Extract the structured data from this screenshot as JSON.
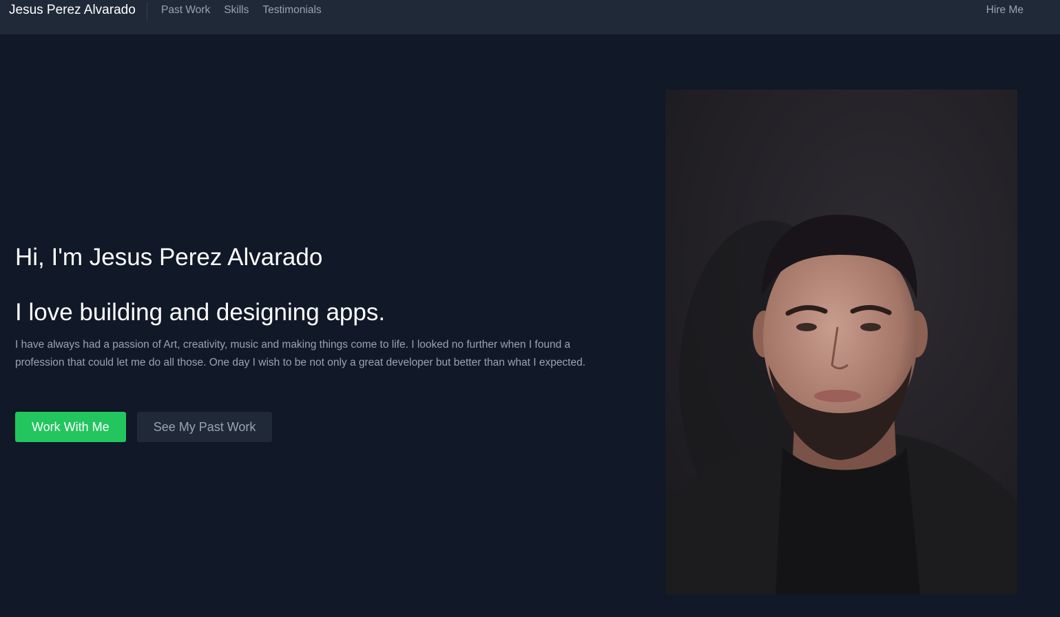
{
  "navbar": {
    "brand": "Jesus Perez Alvarado",
    "links": [
      "Past Work",
      "Skills",
      "Testimonials"
    ],
    "hire": "Hire Me"
  },
  "hero": {
    "greeting": "Hi, I'm Jesus Perez Alvarado",
    "tagline": "I love building and designing apps.",
    "bio": "I have always had a passion of Art, creativity, music and making things come to life. I looked no further when I found a profession that could let me do all those. One day I wish to be not only a great developer but better than what I expected.",
    "primary_button": "Work With Me",
    "secondary_button": "See My Past Work"
  },
  "colors": {
    "background": "#111827",
    "navbar": "#1f2937",
    "accent": "#22c55e",
    "muted_text": "#9ca3af"
  }
}
